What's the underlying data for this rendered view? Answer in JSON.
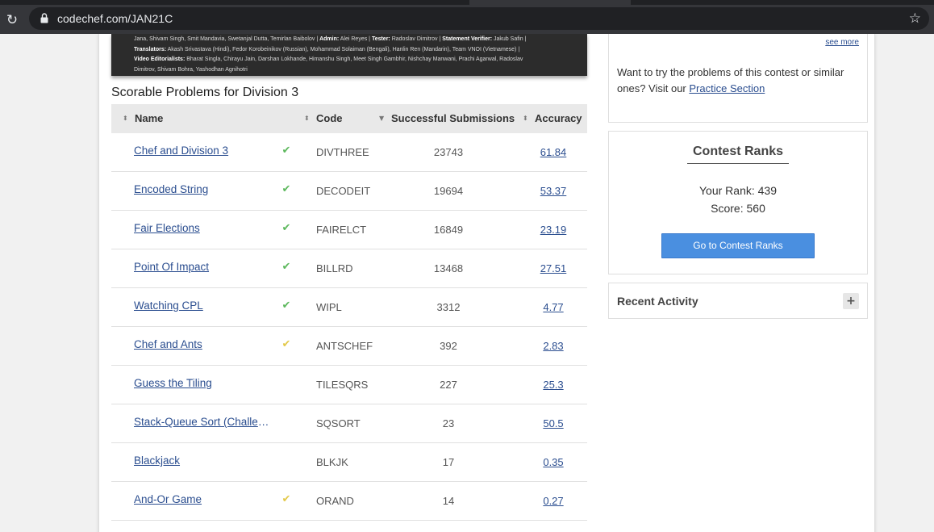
{
  "browser": {
    "url": "codechef.com/JAN21C"
  },
  "banner": {
    "line1": "Jana, Shivam Singh, Smit Mandavia, Swetanjal Dutta, Temirlan Baibolov | ",
    "admin_label": "Admin:",
    "admin_value": " Alei Reyes | ",
    "tester_label": "Tester:",
    "tester_value": " Radoslav Dimitrov | ",
    "verifier_label": "Statement Verifier:",
    "verifier_value": " Jakub Safin |",
    "translators_label": "Translators:",
    "translators_value": " Akash Srivastava (Hindi), Fedor Korobeinikov (Russian), Mohammad Solaiman (Bengali), Hanlin Ren (Mandarin), Team VNOI (Vietnamese) |",
    "editorialists_label": "Video Editorialists:",
    "editorialists_value": " Bharat Singla, Chirayu Jain, Darshan Lokhande, Himanshu Singh, Meet Singh Gambhir, Nishchay Manwani, Prachi Agarwal, Radoslav",
    "line4": "Dimitrov, Shivam Bohra, Yashodhan Agnihotri"
  },
  "section_title": "Scorable Problems for Division 3",
  "table": {
    "headers": {
      "name": "Name",
      "code": "Code",
      "submissions": "Successful Submissions",
      "accuracy": "Accuracy"
    },
    "rows": [
      {
        "name": "Chef and Division 3",
        "status": "solved",
        "code": "DIVTHREE",
        "submissions": "23743",
        "accuracy": "61.84"
      },
      {
        "name": "Encoded String",
        "status": "solved",
        "code": "DECODEIT",
        "submissions": "19694",
        "accuracy": "53.37"
      },
      {
        "name": "Fair Elections",
        "status": "solved",
        "code": "FAIRELCT",
        "submissions": "16849",
        "accuracy": "23.19"
      },
      {
        "name": "Point Of Impact",
        "status": "solved",
        "code": "BILLRD",
        "submissions": "13468",
        "accuracy": "27.51"
      },
      {
        "name": "Watching CPL",
        "status": "solved",
        "code": "WIPL",
        "submissions": "3312",
        "accuracy": "4.77"
      },
      {
        "name": "Chef and Ants",
        "status": "partial",
        "code": "ANTSCHEF",
        "submissions": "392",
        "accuracy": "2.83"
      },
      {
        "name": "Guess the Tiling",
        "status": "none",
        "code": "TILESQRS",
        "submissions": "227",
        "accuracy": "25.3"
      },
      {
        "name": "Stack-Queue Sort (Challenge)",
        "status": "none",
        "code": "SQSORT",
        "submissions": "23",
        "accuracy": "50.5"
      },
      {
        "name": "Blackjack",
        "status": "none",
        "code": "BLKJK",
        "submissions": "17",
        "accuracy": "0.35"
      },
      {
        "name": "And-Or Game",
        "status": "partial",
        "code": "ORAND",
        "submissions": "14",
        "accuracy": "0.27"
      }
    ]
  },
  "sidebar": {
    "see_more": "see more",
    "practice_text": "Want to try the problems of this contest or similar ones? Visit our ",
    "practice_link": "Practice Section",
    "ranks_title": "Contest Ranks",
    "your_rank": "Your Rank: 439",
    "score": "Score: 560",
    "ranks_button": "Go to Contest Ranks",
    "recent_activity": "Recent Activity",
    "plus_icon": "plus-icon"
  },
  "colors": {
    "link": "#2a4d8f",
    "solved": "#5cb85c",
    "partial": "#e3c94a",
    "button": "#4a8fe0"
  }
}
